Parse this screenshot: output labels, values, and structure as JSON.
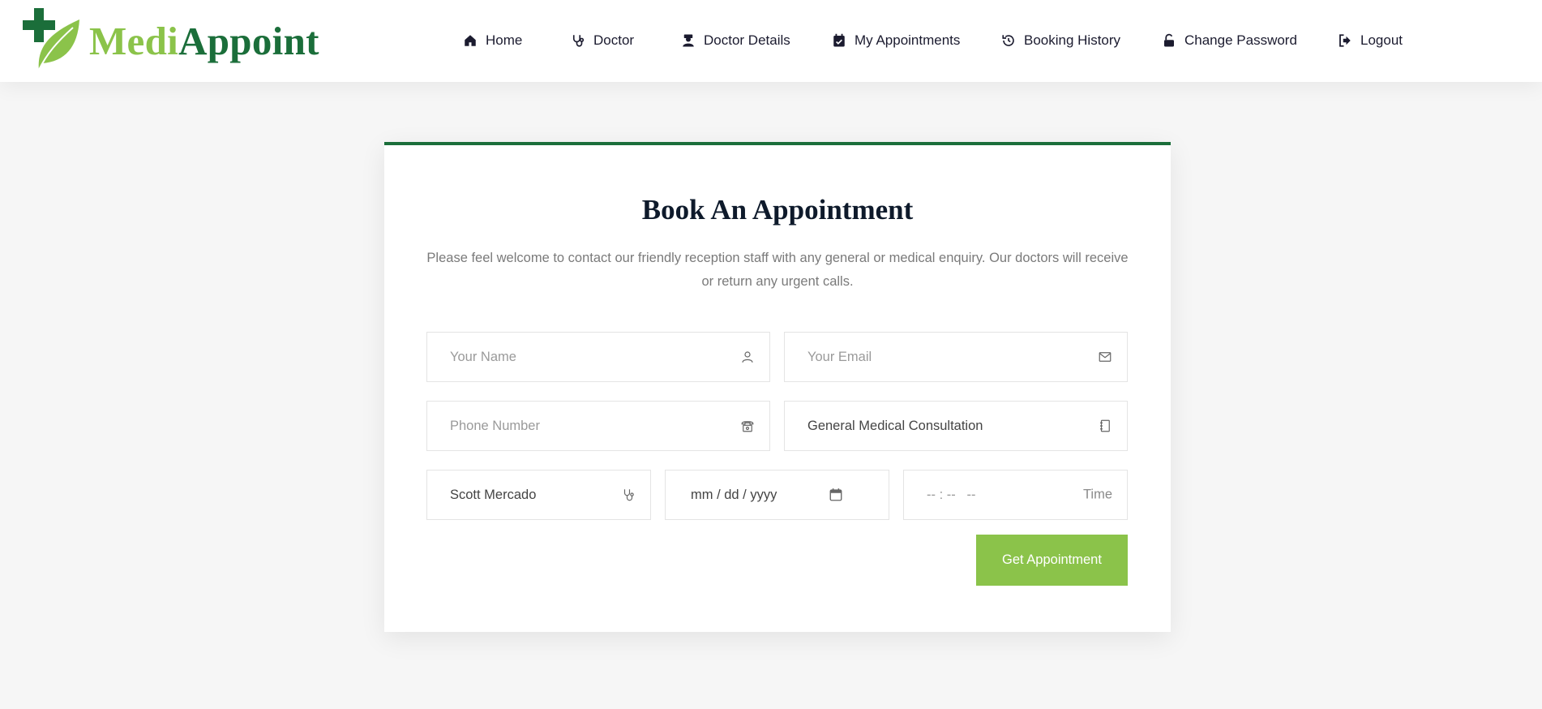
{
  "brand": {
    "name_part1": "Medi",
    "name_part2": "Appoint",
    "colors": {
      "light_green": "#8bc34a",
      "dark_green": "#1b6e3a"
    }
  },
  "nav": {
    "items": [
      {
        "label": "Home",
        "icon": "home-icon"
      },
      {
        "label": "Doctor",
        "icon": "stethoscope-icon"
      },
      {
        "label": "Doctor Details",
        "icon": "doctor-icon"
      },
      {
        "label": "My Appointments",
        "icon": "calendar-check-icon"
      },
      {
        "label": "Booking History",
        "icon": "history-icon"
      },
      {
        "label": "Change Password",
        "icon": "unlock-icon"
      },
      {
        "label": "Logout",
        "icon": "logout-icon"
      }
    ]
  },
  "form": {
    "title": "Book An Appointment",
    "description": "Please feel welcome to contact our friendly reception staff with any general or medical enquiry. Our doctors will receive or return any urgent calls.",
    "name": {
      "placeholder": "Your Name",
      "icon": "user-icon"
    },
    "email": {
      "placeholder": "Your Email",
      "icon": "envelope-icon"
    },
    "phone": {
      "placeholder": "Phone Number",
      "icon": "phone-icon"
    },
    "department": {
      "value": "General Medical Consultation",
      "icon": "notebook-icon"
    },
    "doctor": {
      "value": "Scott Mercado",
      "icon": "stethoscope-icon"
    },
    "date": {
      "value": "mm / dd / yyyy",
      "icon": "calendar-icon"
    },
    "time": {
      "value": "-- : --   --",
      "label": "Time"
    },
    "submit_label": "Get Appointment"
  }
}
